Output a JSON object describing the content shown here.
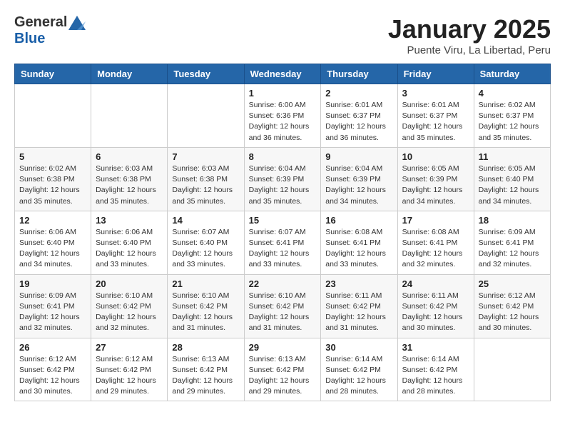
{
  "logo": {
    "general": "General",
    "blue": "Blue"
  },
  "header": {
    "title": "January 2025",
    "subtitle": "Puente Viru, La Libertad, Peru"
  },
  "weekdays": [
    "Sunday",
    "Monday",
    "Tuesday",
    "Wednesday",
    "Thursday",
    "Friday",
    "Saturday"
  ],
  "weeks": [
    [
      {
        "day": "",
        "info": ""
      },
      {
        "day": "",
        "info": ""
      },
      {
        "day": "",
        "info": ""
      },
      {
        "day": "1",
        "info": "Sunrise: 6:00 AM\nSunset: 6:36 PM\nDaylight: 12 hours\nand 36 minutes."
      },
      {
        "day": "2",
        "info": "Sunrise: 6:01 AM\nSunset: 6:37 PM\nDaylight: 12 hours\nand 36 minutes."
      },
      {
        "day": "3",
        "info": "Sunrise: 6:01 AM\nSunset: 6:37 PM\nDaylight: 12 hours\nand 35 minutes."
      },
      {
        "day": "4",
        "info": "Sunrise: 6:02 AM\nSunset: 6:37 PM\nDaylight: 12 hours\nand 35 minutes."
      }
    ],
    [
      {
        "day": "5",
        "info": "Sunrise: 6:02 AM\nSunset: 6:38 PM\nDaylight: 12 hours\nand 35 minutes."
      },
      {
        "day": "6",
        "info": "Sunrise: 6:03 AM\nSunset: 6:38 PM\nDaylight: 12 hours\nand 35 minutes."
      },
      {
        "day": "7",
        "info": "Sunrise: 6:03 AM\nSunset: 6:38 PM\nDaylight: 12 hours\nand 35 minutes."
      },
      {
        "day": "8",
        "info": "Sunrise: 6:04 AM\nSunset: 6:39 PM\nDaylight: 12 hours\nand 35 minutes."
      },
      {
        "day": "9",
        "info": "Sunrise: 6:04 AM\nSunset: 6:39 PM\nDaylight: 12 hours\nand 34 minutes."
      },
      {
        "day": "10",
        "info": "Sunrise: 6:05 AM\nSunset: 6:39 PM\nDaylight: 12 hours\nand 34 minutes."
      },
      {
        "day": "11",
        "info": "Sunrise: 6:05 AM\nSunset: 6:40 PM\nDaylight: 12 hours\nand 34 minutes."
      }
    ],
    [
      {
        "day": "12",
        "info": "Sunrise: 6:06 AM\nSunset: 6:40 PM\nDaylight: 12 hours\nand 34 minutes."
      },
      {
        "day": "13",
        "info": "Sunrise: 6:06 AM\nSunset: 6:40 PM\nDaylight: 12 hours\nand 33 minutes."
      },
      {
        "day": "14",
        "info": "Sunrise: 6:07 AM\nSunset: 6:40 PM\nDaylight: 12 hours\nand 33 minutes."
      },
      {
        "day": "15",
        "info": "Sunrise: 6:07 AM\nSunset: 6:41 PM\nDaylight: 12 hours\nand 33 minutes."
      },
      {
        "day": "16",
        "info": "Sunrise: 6:08 AM\nSunset: 6:41 PM\nDaylight: 12 hours\nand 33 minutes."
      },
      {
        "day": "17",
        "info": "Sunrise: 6:08 AM\nSunset: 6:41 PM\nDaylight: 12 hours\nand 32 minutes."
      },
      {
        "day": "18",
        "info": "Sunrise: 6:09 AM\nSunset: 6:41 PM\nDaylight: 12 hours\nand 32 minutes."
      }
    ],
    [
      {
        "day": "19",
        "info": "Sunrise: 6:09 AM\nSunset: 6:41 PM\nDaylight: 12 hours\nand 32 minutes."
      },
      {
        "day": "20",
        "info": "Sunrise: 6:10 AM\nSunset: 6:42 PM\nDaylight: 12 hours\nand 32 minutes."
      },
      {
        "day": "21",
        "info": "Sunrise: 6:10 AM\nSunset: 6:42 PM\nDaylight: 12 hours\nand 31 minutes."
      },
      {
        "day": "22",
        "info": "Sunrise: 6:10 AM\nSunset: 6:42 PM\nDaylight: 12 hours\nand 31 minutes."
      },
      {
        "day": "23",
        "info": "Sunrise: 6:11 AM\nSunset: 6:42 PM\nDaylight: 12 hours\nand 31 minutes."
      },
      {
        "day": "24",
        "info": "Sunrise: 6:11 AM\nSunset: 6:42 PM\nDaylight: 12 hours\nand 30 minutes."
      },
      {
        "day": "25",
        "info": "Sunrise: 6:12 AM\nSunset: 6:42 PM\nDaylight: 12 hours\nand 30 minutes."
      }
    ],
    [
      {
        "day": "26",
        "info": "Sunrise: 6:12 AM\nSunset: 6:42 PM\nDaylight: 12 hours\nand 30 minutes."
      },
      {
        "day": "27",
        "info": "Sunrise: 6:12 AM\nSunset: 6:42 PM\nDaylight: 12 hours\nand 29 minutes."
      },
      {
        "day": "28",
        "info": "Sunrise: 6:13 AM\nSunset: 6:42 PM\nDaylight: 12 hours\nand 29 minutes."
      },
      {
        "day": "29",
        "info": "Sunrise: 6:13 AM\nSunset: 6:42 PM\nDaylight: 12 hours\nand 29 minutes."
      },
      {
        "day": "30",
        "info": "Sunrise: 6:14 AM\nSunset: 6:42 PM\nDaylight: 12 hours\nand 28 minutes."
      },
      {
        "day": "31",
        "info": "Sunrise: 6:14 AM\nSunset: 6:42 PM\nDaylight: 12 hours\nand 28 minutes."
      },
      {
        "day": "",
        "info": ""
      }
    ]
  ]
}
